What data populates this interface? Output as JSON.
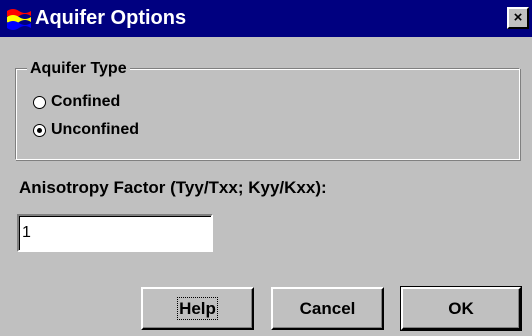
{
  "window": {
    "title": "Aquifer Options",
    "icon": "app-icon",
    "close_label": "×"
  },
  "aquifer_type": {
    "legend": "Aquifer Type",
    "options": [
      {
        "label": "Confined",
        "checked": false
      },
      {
        "label": "Unconfined",
        "checked": true
      }
    ]
  },
  "anisotropy": {
    "label": "Anisotropy Factor (Tyy/Txx; Kyy/Kxx):",
    "value": "1"
  },
  "buttons": {
    "help": "Help",
    "cancel": "Cancel",
    "ok": "OK"
  },
  "colors": {
    "title_bar": "#000080",
    "face": "#c0c0c0"
  }
}
